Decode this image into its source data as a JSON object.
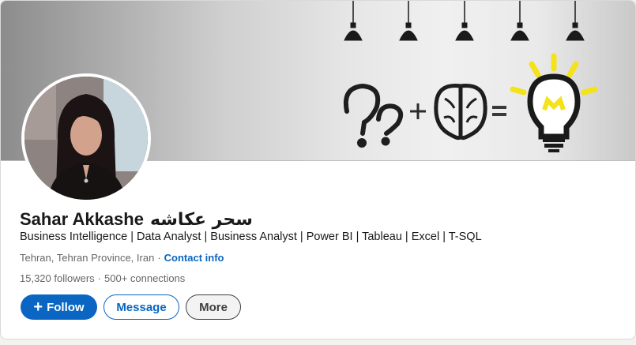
{
  "profile": {
    "name": "Sahar Akkashe",
    "name_native": "سحر عکاشه",
    "headline": "Business Intelligence | Data Analyst | Business Analyst | Power BI | Tableau | Excel | T-SQL",
    "location": "Tehran, Tehran Province, Iran",
    "contact_label": "Contact info",
    "followers": "15,320 followers",
    "connections": "500+ connections"
  },
  "actions": {
    "follow_label": "Follow",
    "message_label": "Message",
    "more_label": "More"
  },
  "icons": {
    "follow": "plus-icon",
    "banner": [
      "pendant-lamp-icon",
      "question-marks-icon",
      "brain-icon",
      "lightbulb-icon"
    ]
  },
  "colors": {
    "accent": "#0a66c2",
    "bulb_glow": "#f4e21a",
    "text": "#191919",
    "muted": "#666666"
  }
}
